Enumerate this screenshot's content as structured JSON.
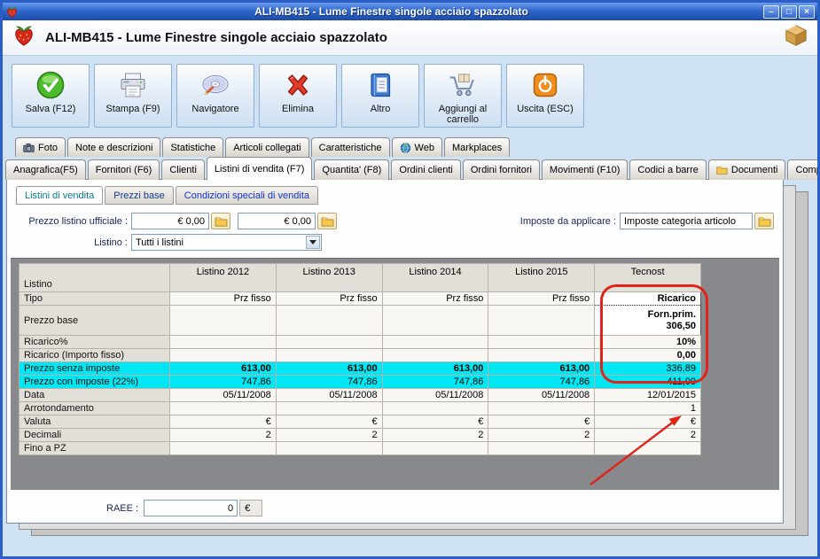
{
  "colors": {
    "titlebar_blue": "#2a64c8",
    "cyan_row": "#00e6f2",
    "annotation_red": "#e0241a",
    "panel_gray": "#87898c"
  },
  "titlebar": {
    "title": "ALI-MB415 - Lume Finestre singole acciaio spazzolato",
    "controls": {
      "minimize": "–",
      "maximize": "□",
      "close": "×"
    }
  },
  "header": {
    "title": "ALI-MB415 - Lume Finestre singole acciaio spazzolato"
  },
  "toolbar": {
    "buttons": [
      {
        "id": "salva",
        "label": "Salva (F12)",
        "icon": "save-icon"
      },
      {
        "id": "stampa",
        "label": "Stampa (F9)",
        "icon": "printer-icon"
      },
      {
        "id": "navigatore",
        "label": "Navigatore",
        "icon": "navigator-icon"
      },
      {
        "id": "elimina",
        "label": "Elimina",
        "icon": "delete-icon"
      },
      {
        "id": "altro",
        "label": "Altro",
        "icon": "book-icon"
      },
      {
        "id": "aggiungi-carrello",
        "label": "Aggiungi al carrello",
        "icon": "cart-icon"
      },
      {
        "id": "uscita",
        "label": "Uscita (ESC)",
        "icon": "exit-icon"
      }
    ]
  },
  "tabs_top": [
    {
      "label": "Foto",
      "icon": "camera-icon"
    },
    {
      "label": "Note e descrizioni"
    },
    {
      "label": "Statistiche"
    },
    {
      "label": "Articoli collegati"
    },
    {
      "label": "Caratteristiche"
    },
    {
      "label": "Web",
      "icon": "globe-icon"
    },
    {
      "label": "Markplaces"
    }
  ],
  "tabs_main": [
    {
      "label": "Anagrafica(F5)"
    },
    {
      "label": "Fornitori (F6)"
    },
    {
      "label": "Clienti"
    },
    {
      "label": "Listini di vendita (F7)",
      "active": true
    },
    {
      "label": "Quantita' (F8)"
    },
    {
      "label": "Ordini clienti"
    },
    {
      "label": "Ordini fornitori"
    },
    {
      "label": "Movimenti (F10)"
    },
    {
      "label": "Codici a barre"
    },
    {
      "label": "Documenti",
      "icon": "folder-icon"
    },
    {
      "label": "Composizioni"
    }
  ],
  "subtabs": [
    {
      "label": "Listini di vendita",
      "active": true
    },
    {
      "label": "Prezzi base"
    },
    {
      "label": "Condizioni speciali di vendita"
    }
  ],
  "form": {
    "prezzo_listino_label": "Prezzo listino ufficiale :",
    "prezzo1": "€ 0,00",
    "prezzo2": "€ 0,00",
    "imposte_label": "Imposte da applicare :",
    "imposte_value": "Imposte categoria articolo",
    "listino_label": "Listino :",
    "listino_value": "Tutti i listini"
  },
  "grid": {
    "row_header": "Listino",
    "columns": [
      "Listino 2012",
      "Listino 2013",
      "Listino 2014",
      "Listino 2015",
      "Tecnost"
    ],
    "rows": [
      {
        "label": "Tipo",
        "values": [
          "Prz fisso",
          "Prz fisso",
          "Prz fisso",
          "Prz fisso",
          "Ricarico"
        ]
      },
      {
        "label": "Prezzo base",
        "values": [
          "",
          "",
          "",
          "",
          "Forn.prim.\n306,50"
        ]
      },
      {
        "label": "Ricarico%",
        "values": [
          "",
          "",
          "",
          "",
          "10%"
        ]
      },
      {
        "label": "Ricarico (Importo fisso)",
        "values": [
          "",
          "",
          "",
          "",
          "0,00"
        ]
      },
      {
        "label": "Prezzo senza imposte",
        "values": [
          "613,00",
          "613,00",
          "613,00",
          "613,00",
          "336,89"
        ]
      },
      {
        "label": "Prezzo con imposte (22%)",
        "values": [
          "747,86",
          "747,86",
          "747,86",
          "747,86",
          "411,00"
        ]
      },
      {
        "label": "Data",
        "values": [
          "05/11/2008",
          "05/11/2008",
          "05/11/2008",
          "05/11/2008",
          "12/01/2015"
        ]
      },
      {
        "label": "Arrotondamento",
        "values": [
          "",
          "",
          "",
          "",
          "1"
        ]
      },
      {
        "label": "Valuta",
        "values": [
          "€",
          "€",
          "€",
          "€",
          "€"
        ]
      },
      {
        "label": "Decimali",
        "values": [
          "2",
          "2",
          "2",
          "2",
          "2"
        ]
      },
      {
        "label": "Fino a PZ",
        "values": [
          "",
          "",
          "",
          "",
          ""
        ]
      }
    ]
  },
  "raee": {
    "label": "RAEE :",
    "value": "0",
    "currency": "€"
  }
}
